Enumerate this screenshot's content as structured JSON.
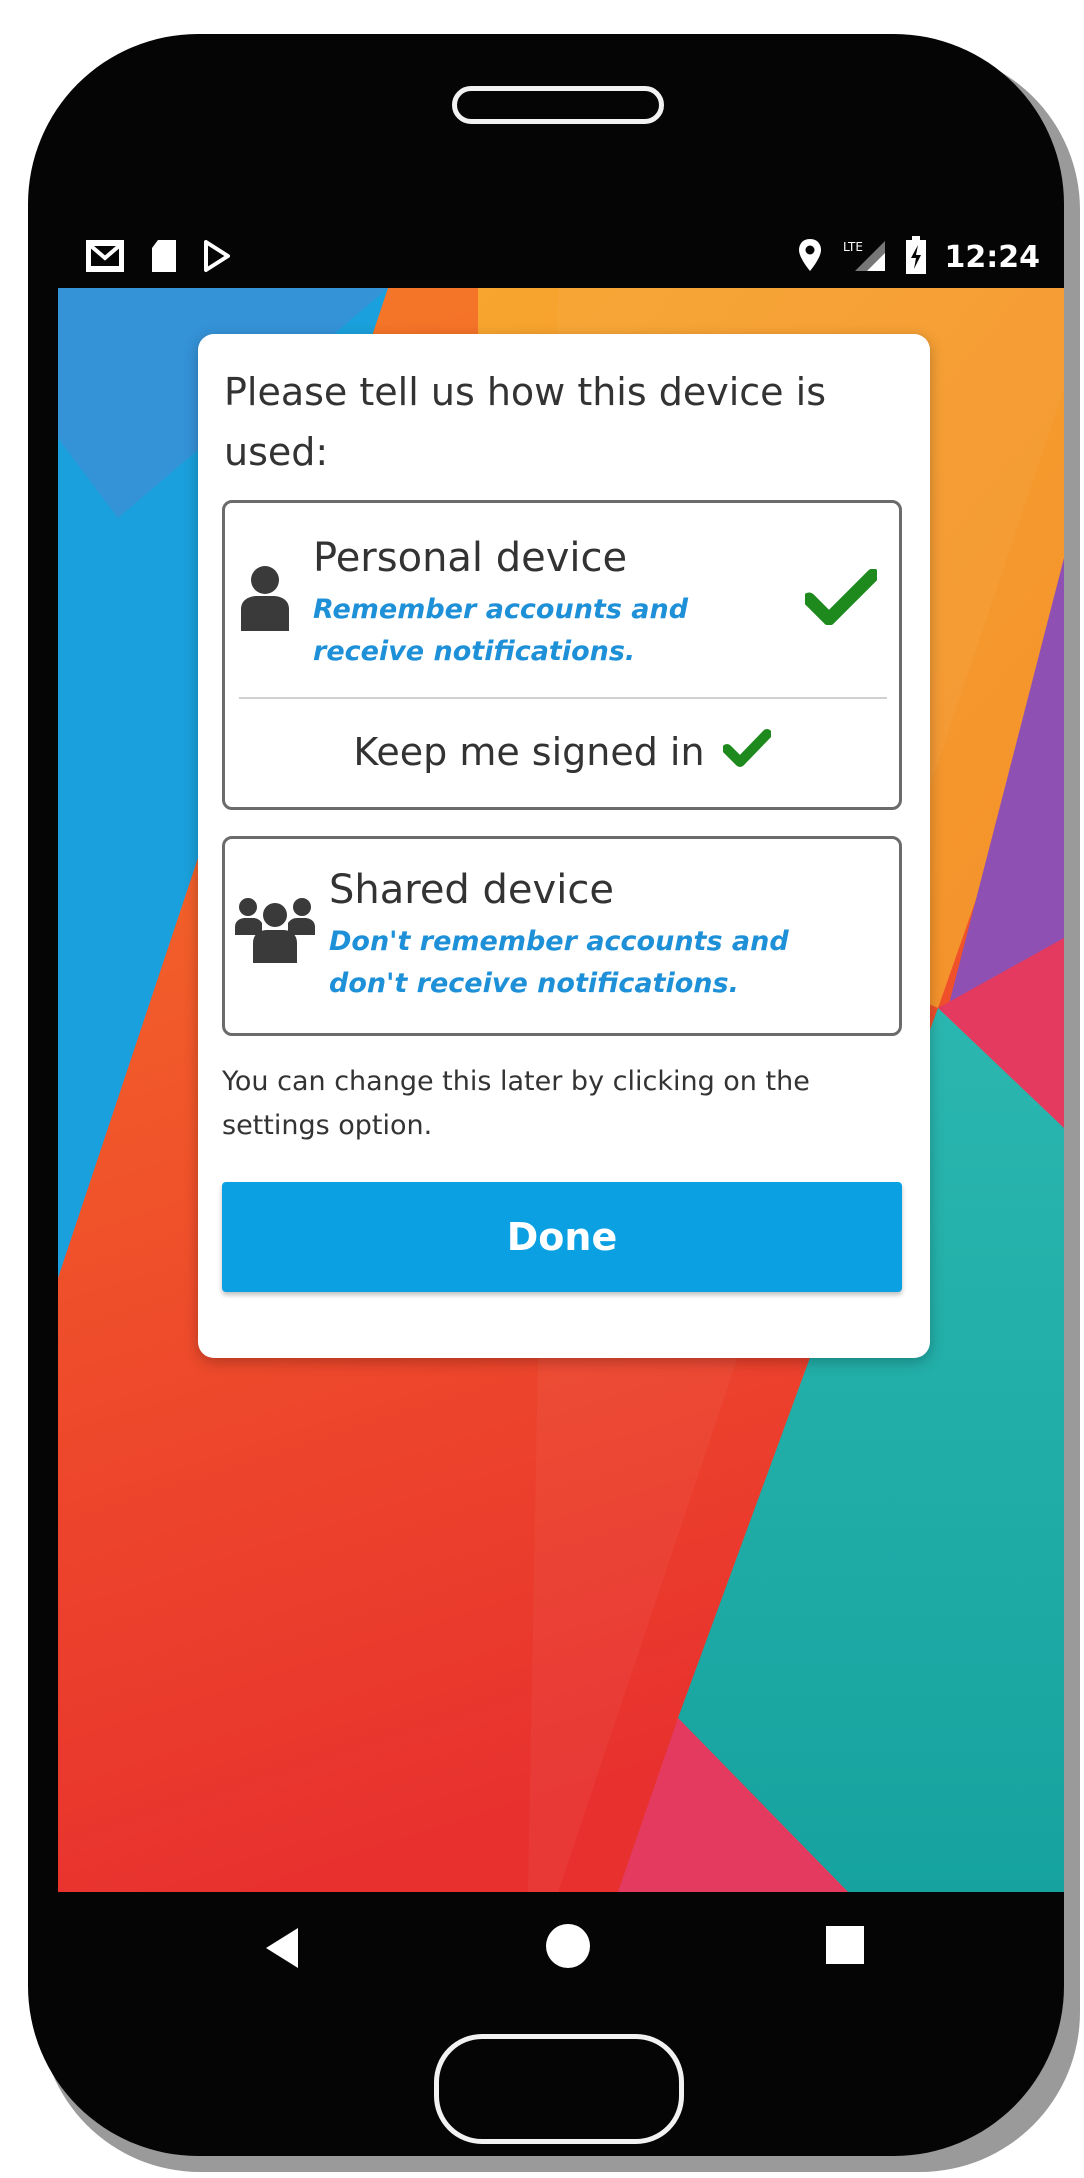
{
  "status_bar": {
    "time": "12:24",
    "left_icons": [
      "mail-icon",
      "sd-card-icon",
      "play-store-icon"
    ],
    "right_icons": [
      "location-icon",
      "lte-signal-icon",
      "battery-charging-icon"
    ]
  },
  "dialog": {
    "title": "Please tell us how this device is used:",
    "personal": {
      "title": "Personal device",
      "subtitle": "Remember accounts and receive notifications.",
      "selected": true,
      "icon": "person-icon"
    },
    "keep_signed_in": {
      "label": "Keep me signed in",
      "checked": true
    },
    "shared": {
      "title": "Shared device",
      "subtitle": "Don't remember accounts and don't receive notifications.",
      "selected": false,
      "icon": "group-icon"
    },
    "footnote": "You can change this later by clicking on the settings option.",
    "done_label": "Done"
  },
  "nav_bar": {
    "buttons": [
      "back-icon",
      "home-icon",
      "recents-icon"
    ]
  },
  "colors": {
    "accent": "#0aa0e2",
    "subtitle_blue": "#1e90d8",
    "check_green": "#1e8a1e",
    "text": "#333333"
  }
}
